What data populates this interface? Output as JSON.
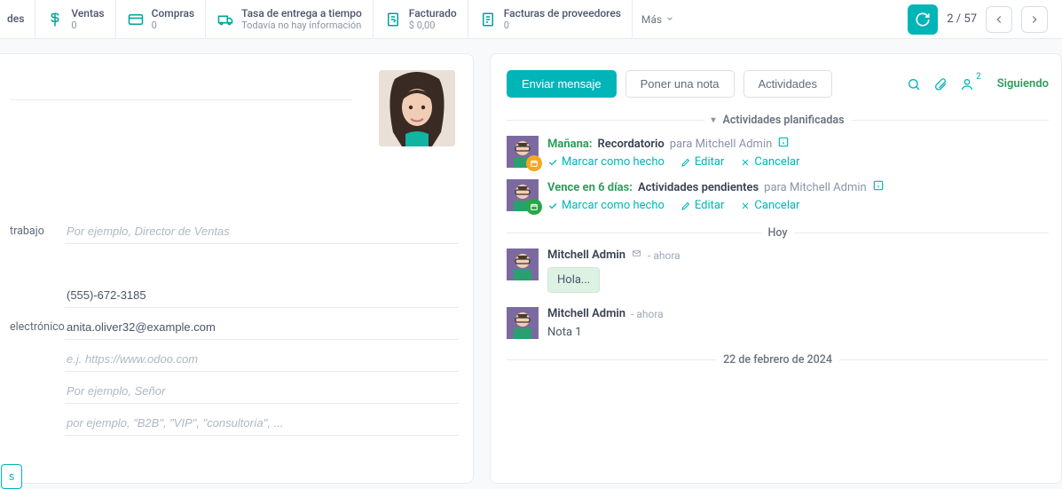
{
  "stats": [
    {
      "icon": "dollar",
      "label": "Ventas",
      "value": "0"
    },
    {
      "icon": "card",
      "label": "Compras",
      "value": "0"
    },
    {
      "icon": "truck",
      "label": "Tasa de entrega a tiempo",
      "value": "Todavía no hay información"
    },
    {
      "icon": "invoice",
      "label": "Facturado",
      "value": "$ 0,00"
    },
    {
      "icon": "vendor",
      "label": "Facturas de proveedores",
      "value": "0"
    }
  ],
  "more_label": "Más",
  "pager": {
    "current": "2 / 57"
  },
  "form": {
    "labels": {
      "job": "trabajo",
      "email": "electrónico"
    },
    "placeholders": {
      "job": "Por ejemplo, Director de Ventas",
      "website": "e.j. https://www.odoo.com",
      "title": "Por ejemplo, Señor",
      "tags": "por ejemplo, \"B2B\", \"VIP\", \"consultoría\", ..."
    },
    "values": {
      "phone": "(555)-672-3185",
      "email": "anita.oliver32@example.com"
    },
    "btn_partial": "s"
  },
  "chatter": {
    "buttons": {
      "send": "Enviar mensaje",
      "note": "Poner una nota",
      "activities": "Actividades"
    },
    "follower_count": "2",
    "following": "Siguiendo",
    "planned_header": "Actividades planificadas",
    "activities": [
      {
        "due": "Mañana:",
        "type": "Recordatorio",
        "for_prefix": "para",
        "for_user": "Mitchell Admin",
        "badge": "orange"
      },
      {
        "due": "Vence en 6 días:",
        "type": "Actividades pendientes",
        "for_prefix": "para",
        "for_user": "Mitchell Admin",
        "badge": "green"
      }
    ],
    "actions": {
      "done": "Marcar como hecho",
      "edit": "Editar",
      "cancel": "Cancelar"
    },
    "today_header": "Hoy",
    "messages": [
      {
        "author": "Mitchell Admin",
        "time": "ahora",
        "bubble": "Hola...",
        "envelope": true
      },
      {
        "author": "Mitchell Admin",
        "time": "ahora",
        "note": "Nota 1"
      }
    ],
    "date_header": "22 de febrero de 2024"
  }
}
